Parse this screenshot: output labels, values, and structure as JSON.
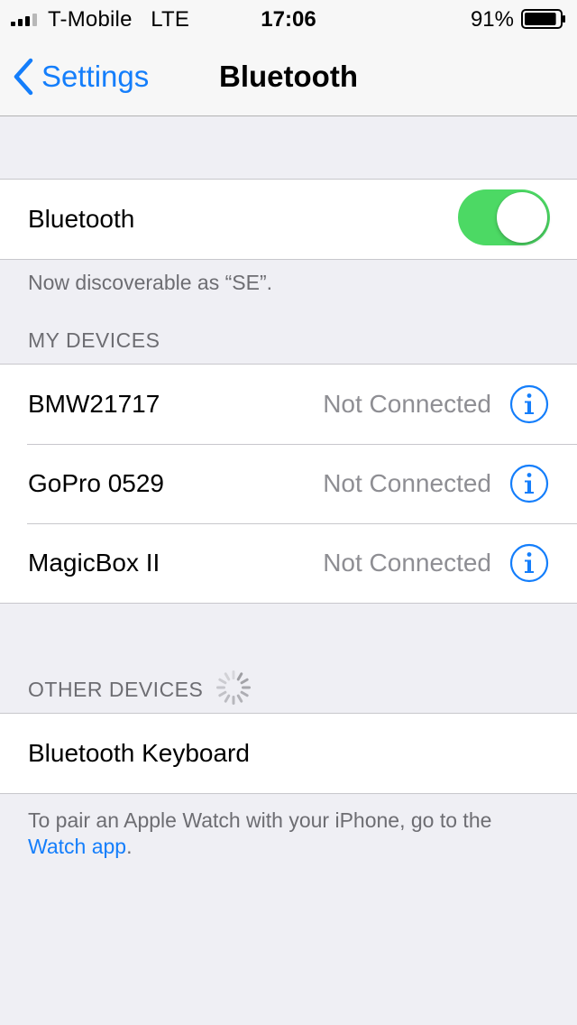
{
  "status_bar": {
    "carrier": "T-Mobile",
    "network": "LTE",
    "time": "17:06",
    "battery_percent": "91%",
    "battery_level": 0.91,
    "signal_bars": 3
  },
  "nav": {
    "back_label": "Settings",
    "title": "Bluetooth"
  },
  "bluetooth": {
    "label": "Bluetooth",
    "enabled": true,
    "discoverable_text": "Now discoverable as “SE”."
  },
  "my_devices": {
    "header": "MY DEVICES",
    "items": [
      {
        "name": "BMW21717",
        "status": "Not Connected"
      },
      {
        "name": "GoPro 0529",
        "status": "Not Connected"
      },
      {
        "name": "MagicBox II",
        "status": "Not Connected"
      }
    ]
  },
  "other_devices": {
    "header": "OTHER DEVICES",
    "items": [
      {
        "name": "Bluetooth Keyboard"
      }
    ]
  },
  "footer": {
    "text": "To pair an Apple Watch with your iPhone, go to the",
    "link": "Watch app",
    "suffix": "."
  },
  "colors": {
    "accent": "#147efb",
    "toggle_on": "#4cd964",
    "background": "#efeff4",
    "secondary_text": "#8e8e93"
  },
  "icons": [
    "signal-icon",
    "battery-icon",
    "back-chevron-icon",
    "info-icon",
    "loading-spinner-icon"
  ]
}
